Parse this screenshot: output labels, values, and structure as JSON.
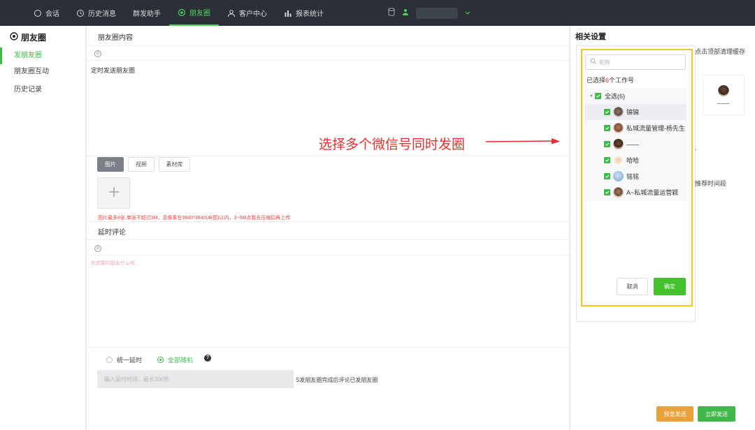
{
  "nav": {
    "items": [
      {
        "label": "会话",
        "icon": "chat-icon"
      },
      {
        "label": "历史消息",
        "icon": "history-icon"
      },
      {
        "label": "群发助手",
        "icon": ""
      },
      {
        "label": "朋友圈",
        "icon": "moments-icon",
        "active": true
      },
      {
        "label": "客户中心",
        "icon": "user-icon"
      },
      {
        "label": "报表统计",
        "icon": "bar-chart-icon"
      }
    ]
  },
  "sidebar": {
    "title": "朋友圈",
    "items": [
      {
        "label": "发朋友圈",
        "active": true
      },
      {
        "label": "朋友圈互动"
      },
      {
        "label": "历史记录"
      }
    ]
  },
  "main": {
    "content_title": "朋友圈内容",
    "scheduled_label": "定时发送朋友圈",
    "tabs": [
      "图片",
      "视频",
      "素材库"
    ],
    "upload_hint": "图片最多9张,单张不超过3M，且像素在3840*3840(4k图)以内，3~5M点我去压缩后再上传",
    "comment_title": "延时评论",
    "comment_placeholder": "你想要的朋友什么呢 ...",
    "radio_uniform": "统一延时",
    "radio_random": "全部随机",
    "delay_placeholder": "输入延时时间，最长300秒",
    "delay_note": "S发朋友圈完成后评论已发朋友圈"
  },
  "annotation": "选择多个微信号同时发圈",
  "right": {
    "title": "相关设置",
    "behind_text": "点击顶部清理缓存",
    "behind_text2": "推荐时间段",
    "preview_button": "预览发送",
    "send_button": "立即发送"
  },
  "popup": {
    "search_placeholder": "昵称",
    "count_prefix": "已选择",
    "count": "6",
    "count_suffix": "个工作号",
    "select_all": "全选(6)",
    "accounts": [
      {
        "name": "锦锦"
      },
      {
        "name": "私城流量管理-杨先生"
      },
      {
        "name": "——"
      },
      {
        "name": "哈哈"
      },
      {
        "name": "铭铭"
      },
      {
        "name": "A~私城流量运营颖"
      }
    ],
    "cancel": "取消",
    "confirm": "确定"
  },
  "colors": {
    "accent": "#3fb94a",
    "nav_bg": "#2b2f36",
    "highlight": "#f3c623",
    "annotation": "#e8312f"
  }
}
